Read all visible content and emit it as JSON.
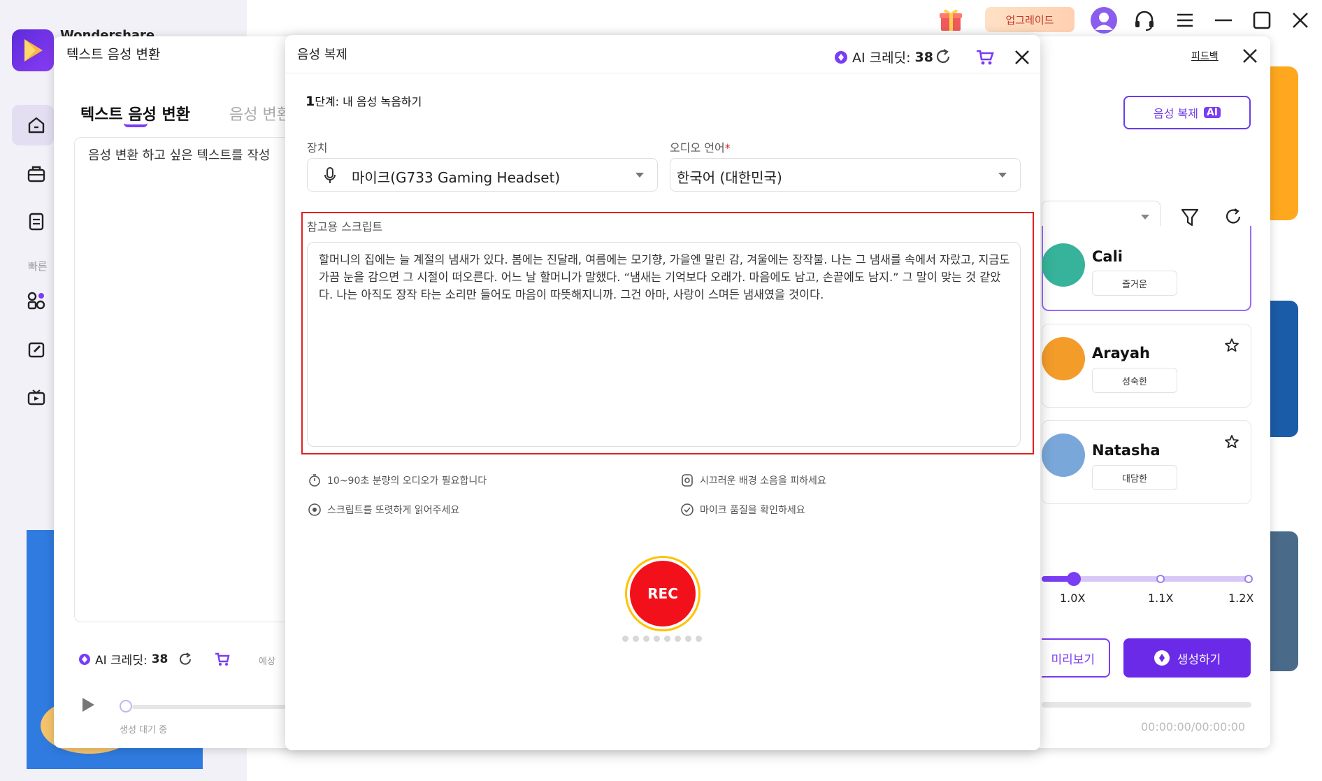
{
  "app": {
    "title": "Wondershare",
    "quick_label": "빠른",
    "upgrade_label": "업그레이드"
  },
  "tts_dialog": {
    "title": "텍스트 음성 변환",
    "feedback": "피드백",
    "tab_active": "텍스트 음성 변환",
    "tab_inactive": "음성 변환",
    "placeholder": "음성 변환 하고 싶은 텍스트를 작성",
    "credit_label": "AI 크레딧:",
    "credit_value": "38",
    "estimate": "예상",
    "status": "생성 대기 중"
  },
  "right_panel": {
    "voice_clone_button": "음성 복제",
    "voice_clone_badge": "AI",
    "voices": [
      {
        "name": "Cali",
        "tag": "즐거운"
      },
      {
        "name": "Arayah",
        "tag": "성숙한"
      },
      {
        "name": "Natasha",
        "tag": "대담한"
      }
    ],
    "speeds": [
      "1.0X",
      "1.1X",
      "1.2X"
    ],
    "speed_value": 1.0,
    "preview_button": "미리보기",
    "generate_button": "생성하기",
    "time": "00:00:00/00:00:00"
  },
  "voice_clone": {
    "title": "음성 복제",
    "credit_label": "AI 크레딧:",
    "credit_value": "38",
    "step_num": "1",
    "step_text": "단계: 내 음성 녹음하기",
    "device_label": "장치",
    "device_value": "마이크(G733 Gaming Headset)",
    "language_label": "오디오 언어",
    "language_required": "*",
    "language_value": "한국어 (대한민국)",
    "script_label": "참고용 스크립트",
    "script_text": "할머니의 집에는 늘 계절의 냄새가 있다. 봄에는 진달래, 여름에는 모기향, 가을엔 말린 감, 겨울에는 장작불. 나는 그 냄새를 속에서 자랐고, 지금도 가끔 눈을 감으면 그 시절이 떠오른다. 어느 날 할머니가 말했다. “냄새는 기억보다 오래가. 마음에도 남고, 손끝에도 남지.” 그 말이 맞는 것 같았다. 나는 아직도 장작 타는 소리만 들어도 마음이 따뜻해지니까. 그건 아마, 사랑이 스며든 냄새였을 것이다.",
    "tips": [
      "10~90초 분량의 오디오가 필요합니다",
      "시끄러운 배경 소음을 피하세요",
      "스크립트를 또렷하게 읽어주세요",
      "마이크 품질을 확인하세요"
    ],
    "rec_label": "REC"
  },
  "colors": {
    "accent": "#7a3cf5",
    "rec_red": "#f2101a",
    "highlight_border": "#e02020"
  }
}
